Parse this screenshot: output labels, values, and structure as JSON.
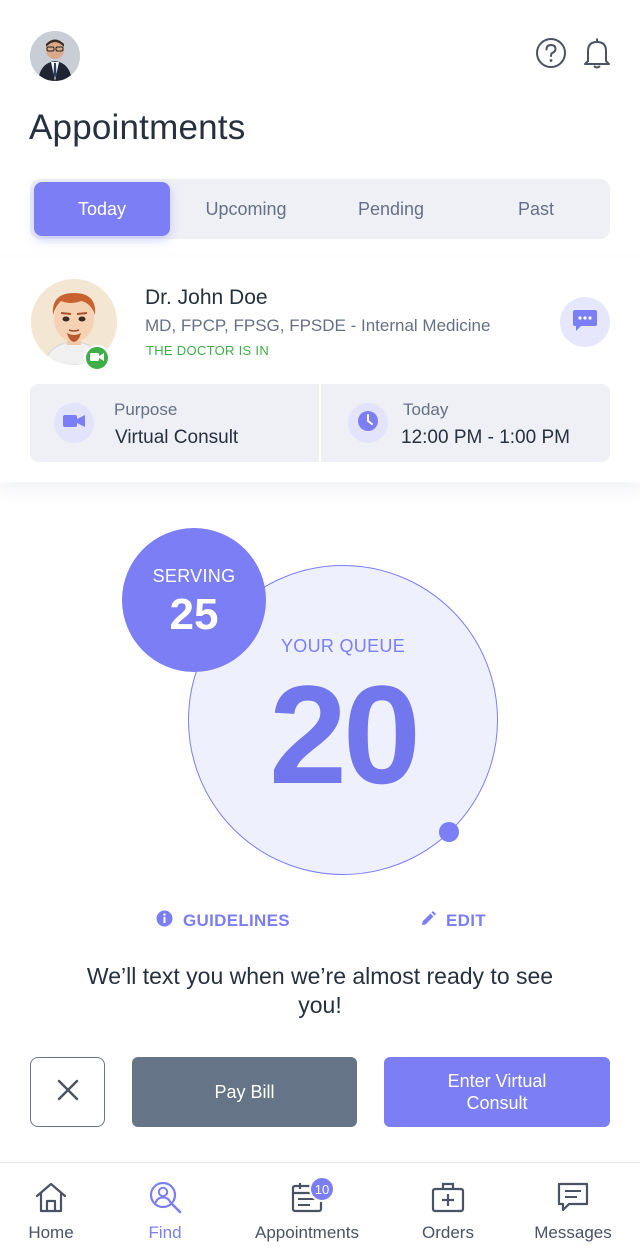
{
  "header": {
    "title": "Appointments",
    "help_icon": "question-circle-icon",
    "notification_icon": "bell-icon"
  },
  "tabs": [
    {
      "label": "Today",
      "active": true
    },
    {
      "label": "Upcoming",
      "active": false
    },
    {
      "label": "Pending",
      "active": false
    },
    {
      "label": "Past",
      "active": false
    }
  ],
  "appointment": {
    "doctor_name": "Dr. John Doe",
    "credentials": "MD, FPCP, FPSG, FPSDE - Internal Medicine",
    "status": "THE DOCTOR IS IN",
    "purpose_label": "Purpose",
    "purpose_value": "Virtual Consult",
    "date_label": "Today",
    "time_value": "12:00 PM - 1:00 PM"
  },
  "queue": {
    "serving_label": "SERVING",
    "serving_number": "25",
    "your_queue_label": "YOUR QUEUE",
    "your_queue_number": "20"
  },
  "links": {
    "guidelines": "GUIDELINES",
    "edit": "EDIT"
  },
  "notice": "We’ll text you when we’re almost ready to see you!",
  "actions": {
    "pay_bill": "Pay Bill",
    "enter_consult": "Enter Virtual Consult"
  },
  "bottom_nav": [
    {
      "label": "Home",
      "icon": "home-icon",
      "active": false
    },
    {
      "label": "Find",
      "icon": "find-doctor-icon",
      "active": true
    },
    {
      "label": "Appointments",
      "icon": "calendar-icon",
      "active": false,
      "badge": "10"
    },
    {
      "label": "Orders",
      "icon": "medical-kit-icon",
      "active": false
    },
    {
      "label": "Messages",
      "icon": "message-icon",
      "active": false
    }
  ],
  "colors": {
    "accent": "#7b7ef4",
    "status_green": "#3fae48",
    "pay_button": "#667487",
    "text_dark": "#27303f",
    "text_muted": "#667085"
  }
}
